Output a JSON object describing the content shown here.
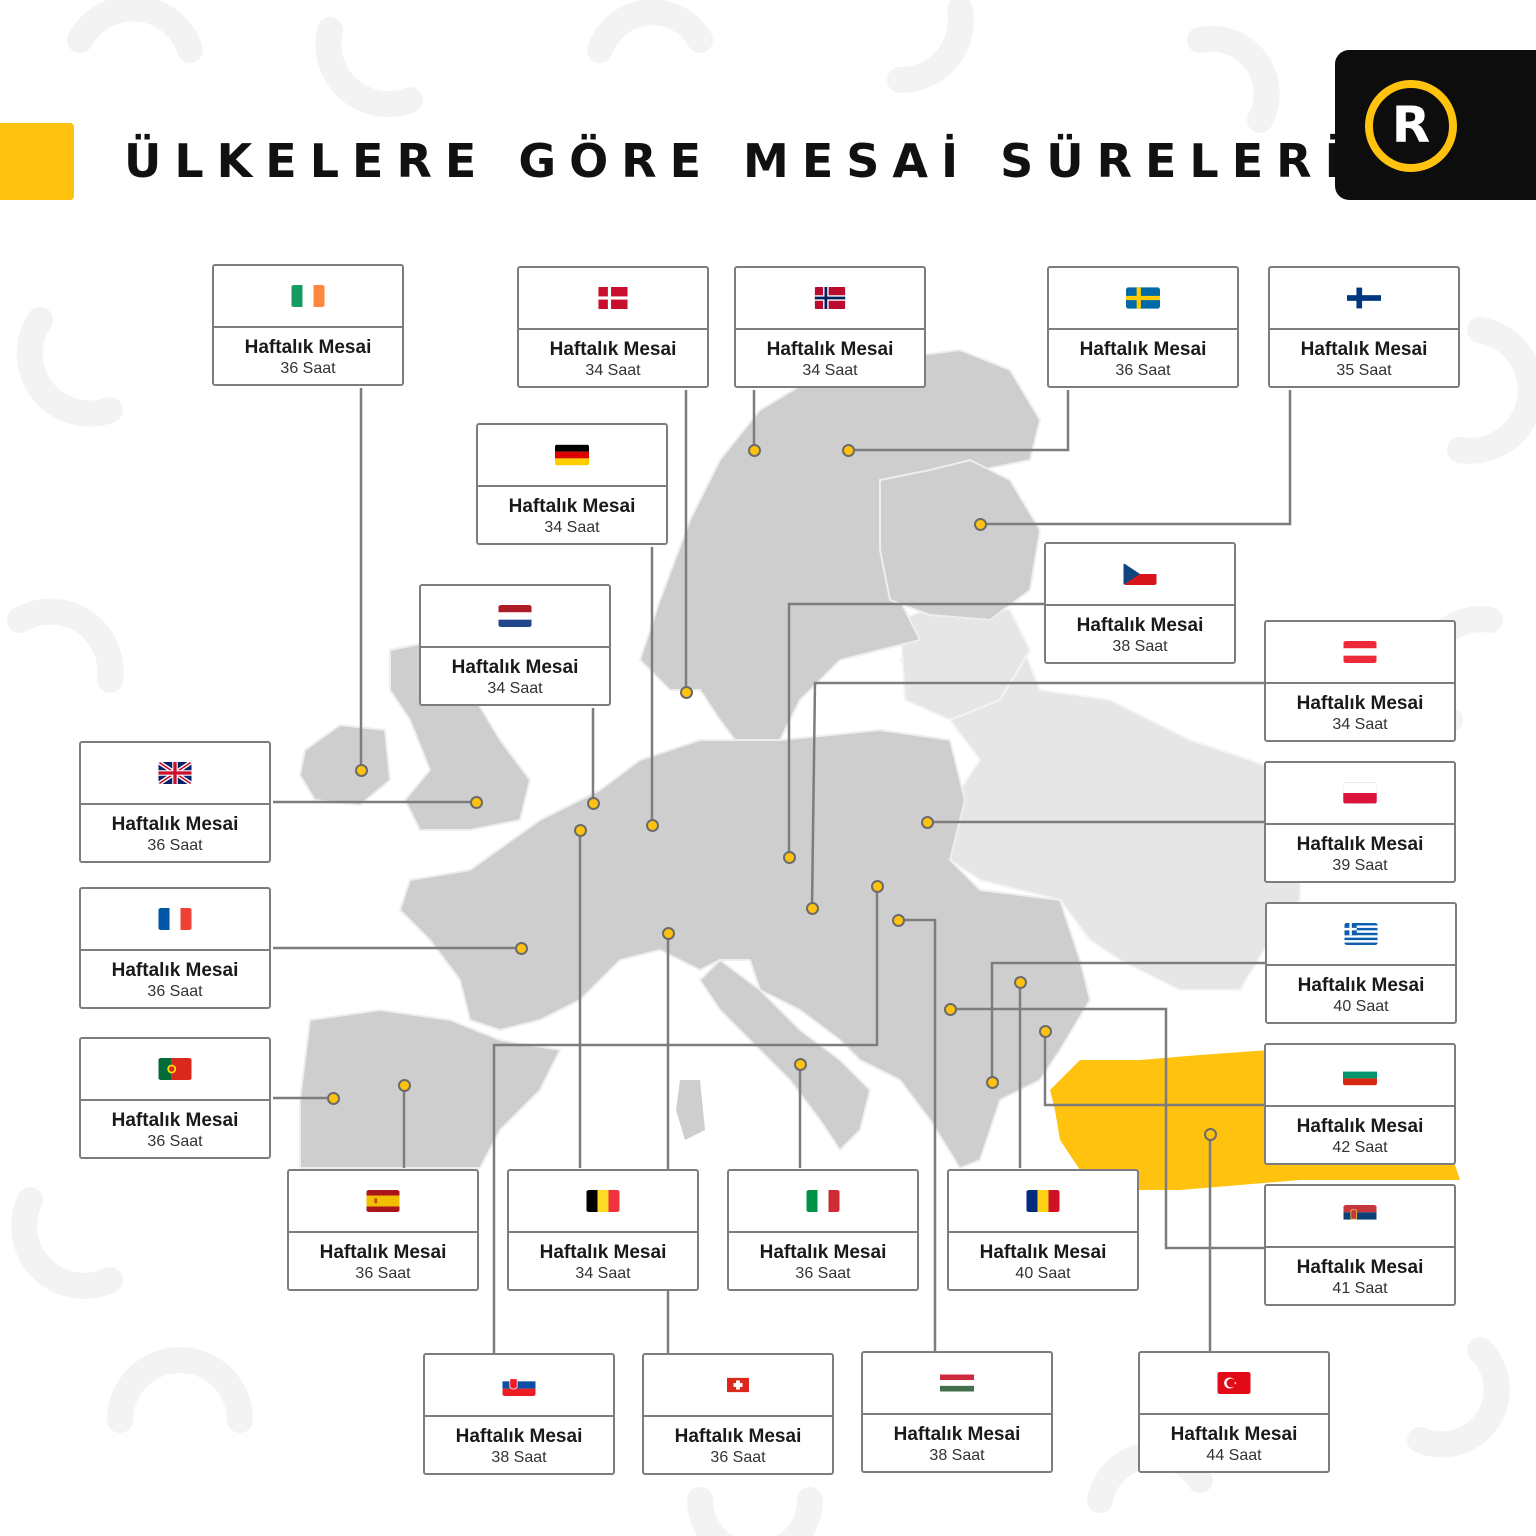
{
  "header": {
    "title": "ÜLKELERE GÖRE MESAİ SÜRELERİ",
    "logo_letter": "R"
  },
  "colors": {
    "accent": "#FFC20E",
    "highlight_country": "#FFC20E",
    "map_land": "#CFCECF",
    "map_land_light": "#E6E6E7",
    "card_border": "#7D7D7D",
    "logo_background": "#0D0D0D"
  },
  "map": {
    "highlighted_country": "Türkiye",
    "countries": [
      {
        "id": "ireland",
        "flag": "ireland-flag",
        "label": "Haftalık Mesai",
        "hours": "36 Saat"
      },
      {
        "id": "denmark",
        "flag": "denmark-flag",
        "label": "Haftalık Mesai",
        "hours": "34 Saat"
      },
      {
        "id": "norway",
        "flag": "norway-flag",
        "label": "Haftalık Mesai",
        "hours": "34 Saat"
      },
      {
        "id": "sweden",
        "flag": "sweden-flag",
        "label": "Haftalık Mesai",
        "hours": "36 Saat"
      },
      {
        "id": "finland",
        "flag": "finland-flag",
        "label": "Haftalık Mesai",
        "hours": "35 Saat"
      },
      {
        "id": "germany",
        "flag": "germany-flag",
        "label": "Haftalık Mesai",
        "hours": "34 Saat"
      },
      {
        "id": "czechia",
        "flag": "czechia-flag",
        "label": "Haftalık Mesai",
        "hours": "38 Saat"
      },
      {
        "id": "netherlands",
        "flag": "netherlands-flag",
        "label": "Haftalık Mesai",
        "hours": "34 Saat"
      },
      {
        "id": "austria",
        "flag": "austria-flag",
        "label": "Haftalık Mesai",
        "hours": "34 Saat"
      },
      {
        "id": "united-kingdom",
        "flag": "uk-flag",
        "label": "Haftalık Mesai",
        "hours": "36 Saat"
      },
      {
        "id": "poland",
        "flag": "poland-flag",
        "label": "Haftalık Mesai",
        "hours": "39 Saat"
      },
      {
        "id": "france",
        "flag": "france-flag",
        "label": "Haftalık Mesai",
        "hours": "36 Saat"
      },
      {
        "id": "greece",
        "flag": "greece-flag",
        "label": "Haftalık Mesai",
        "hours": "40 Saat"
      },
      {
        "id": "portugal",
        "flag": "portugal-flag",
        "label": "Haftalık Mesai",
        "hours": "36 Saat"
      },
      {
        "id": "bulgaria",
        "flag": "bulgaria-flag",
        "label": "Haftalık Mesai",
        "hours": "42 Saat"
      },
      {
        "id": "spain",
        "flag": "spain-flag",
        "label": "Haftalık Mesai",
        "hours": "36 Saat"
      },
      {
        "id": "belgium",
        "flag": "belgium-flag",
        "label": "Haftalık Mesai",
        "hours": "34 Saat"
      },
      {
        "id": "italy",
        "flag": "italy-flag",
        "label": "Haftalık Mesai",
        "hours": "36 Saat"
      },
      {
        "id": "romania",
        "flag": "romania-flag",
        "label": "Haftalık Mesai",
        "hours": "40 Saat"
      },
      {
        "id": "serbia",
        "flag": "serbia-flag",
        "label": "Haftalık Mesai",
        "hours": "41 Saat"
      },
      {
        "id": "slovakia",
        "flag": "slovakia-flag",
        "label": "Haftalık Mesai",
        "hours": "38 Saat"
      },
      {
        "id": "switzerland",
        "flag": "switzerland-flag",
        "label": "Haftalık Mesai",
        "hours": "36 Saat"
      },
      {
        "id": "hungary",
        "flag": "hungary-flag",
        "label": "Haftalık Mesai",
        "hours": "38 Saat"
      },
      {
        "id": "turkey",
        "flag": "turkey-flag",
        "label": "Haftalık Mesai",
        "hours": "44 Saat"
      }
    ]
  }
}
